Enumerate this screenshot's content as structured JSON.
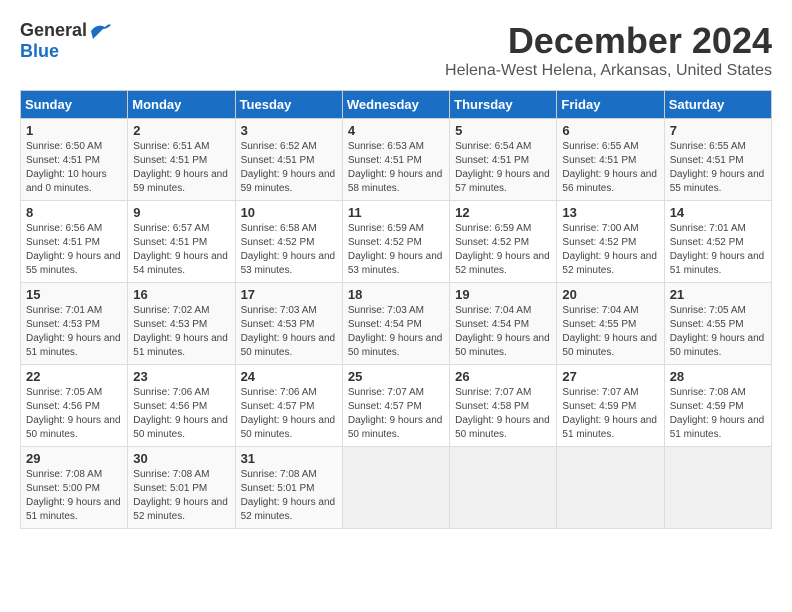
{
  "logo": {
    "general": "General",
    "blue": "Blue"
  },
  "title": "December 2024",
  "location": "Helena-West Helena, Arkansas, United States",
  "weekdays": [
    "Sunday",
    "Monday",
    "Tuesday",
    "Wednesday",
    "Thursday",
    "Friday",
    "Saturday"
  ],
  "weeks": [
    [
      {
        "day": "1",
        "sunrise": "6:50 AM",
        "sunset": "4:51 PM",
        "daylight": "10 hours and 0 minutes."
      },
      {
        "day": "2",
        "sunrise": "6:51 AM",
        "sunset": "4:51 PM",
        "daylight": "9 hours and 59 minutes."
      },
      {
        "day": "3",
        "sunrise": "6:52 AM",
        "sunset": "4:51 PM",
        "daylight": "9 hours and 59 minutes."
      },
      {
        "day": "4",
        "sunrise": "6:53 AM",
        "sunset": "4:51 PM",
        "daylight": "9 hours and 58 minutes."
      },
      {
        "day": "5",
        "sunrise": "6:54 AM",
        "sunset": "4:51 PM",
        "daylight": "9 hours and 57 minutes."
      },
      {
        "day": "6",
        "sunrise": "6:55 AM",
        "sunset": "4:51 PM",
        "daylight": "9 hours and 56 minutes."
      },
      {
        "day": "7",
        "sunrise": "6:55 AM",
        "sunset": "4:51 PM",
        "daylight": "9 hours and 55 minutes."
      }
    ],
    [
      {
        "day": "8",
        "sunrise": "6:56 AM",
        "sunset": "4:51 PM",
        "daylight": "9 hours and 55 minutes."
      },
      {
        "day": "9",
        "sunrise": "6:57 AM",
        "sunset": "4:51 PM",
        "daylight": "9 hours and 54 minutes."
      },
      {
        "day": "10",
        "sunrise": "6:58 AM",
        "sunset": "4:52 PM",
        "daylight": "9 hours and 53 minutes."
      },
      {
        "day": "11",
        "sunrise": "6:59 AM",
        "sunset": "4:52 PM",
        "daylight": "9 hours and 53 minutes."
      },
      {
        "day": "12",
        "sunrise": "6:59 AM",
        "sunset": "4:52 PM",
        "daylight": "9 hours and 52 minutes."
      },
      {
        "day": "13",
        "sunrise": "7:00 AM",
        "sunset": "4:52 PM",
        "daylight": "9 hours and 52 minutes."
      },
      {
        "day": "14",
        "sunrise": "7:01 AM",
        "sunset": "4:52 PM",
        "daylight": "9 hours and 51 minutes."
      }
    ],
    [
      {
        "day": "15",
        "sunrise": "7:01 AM",
        "sunset": "4:53 PM",
        "daylight": "9 hours and 51 minutes."
      },
      {
        "day": "16",
        "sunrise": "7:02 AM",
        "sunset": "4:53 PM",
        "daylight": "9 hours and 51 minutes."
      },
      {
        "day": "17",
        "sunrise": "7:03 AM",
        "sunset": "4:53 PM",
        "daylight": "9 hours and 50 minutes."
      },
      {
        "day": "18",
        "sunrise": "7:03 AM",
        "sunset": "4:54 PM",
        "daylight": "9 hours and 50 minutes."
      },
      {
        "day": "19",
        "sunrise": "7:04 AM",
        "sunset": "4:54 PM",
        "daylight": "9 hours and 50 minutes."
      },
      {
        "day": "20",
        "sunrise": "7:04 AM",
        "sunset": "4:55 PM",
        "daylight": "9 hours and 50 minutes."
      },
      {
        "day": "21",
        "sunrise": "7:05 AM",
        "sunset": "4:55 PM",
        "daylight": "9 hours and 50 minutes."
      }
    ],
    [
      {
        "day": "22",
        "sunrise": "7:05 AM",
        "sunset": "4:56 PM",
        "daylight": "9 hours and 50 minutes."
      },
      {
        "day": "23",
        "sunrise": "7:06 AM",
        "sunset": "4:56 PM",
        "daylight": "9 hours and 50 minutes."
      },
      {
        "day": "24",
        "sunrise": "7:06 AM",
        "sunset": "4:57 PM",
        "daylight": "9 hours and 50 minutes."
      },
      {
        "day": "25",
        "sunrise": "7:07 AM",
        "sunset": "4:57 PM",
        "daylight": "9 hours and 50 minutes."
      },
      {
        "day": "26",
        "sunrise": "7:07 AM",
        "sunset": "4:58 PM",
        "daylight": "9 hours and 50 minutes."
      },
      {
        "day": "27",
        "sunrise": "7:07 AM",
        "sunset": "4:59 PM",
        "daylight": "9 hours and 51 minutes."
      },
      {
        "day": "28",
        "sunrise": "7:08 AM",
        "sunset": "4:59 PM",
        "daylight": "9 hours and 51 minutes."
      }
    ],
    [
      {
        "day": "29",
        "sunrise": "7:08 AM",
        "sunset": "5:00 PM",
        "daylight": "9 hours and 51 minutes."
      },
      {
        "day": "30",
        "sunrise": "7:08 AM",
        "sunset": "5:01 PM",
        "daylight": "9 hours and 52 minutes."
      },
      {
        "day": "31",
        "sunrise": "7:08 AM",
        "sunset": "5:01 PM",
        "daylight": "9 hours and 52 minutes."
      },
      null,
      null,
      null,
      null
    ]
  ]
}
